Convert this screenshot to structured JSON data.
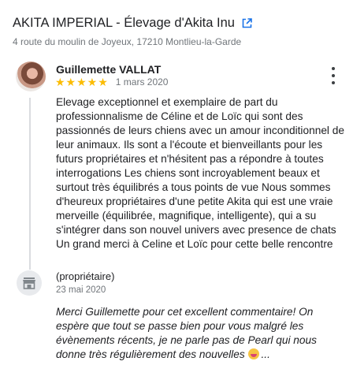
{
  "header": {
    "business_name": "AKITA IMPERIAL - Élevage d'Akita Inu",
    "address": "4 route du moulin de Joyeux, 17210 Montlieu-la-Garde",
    "icons": {
      "external_link": "external-link-icon"
    }
  },
  "review": {
    "reviewer_name": "Guillemette VALLAT",
    "stars": "★★★★★",
    "rating": 5,
    "date": "1 mars 2020",
    "text": "Elevage exceptionnel et exemplaire de part du professionnalisme de Céline et de Loïc qui sont des passionnés de leurs chiens avec un amour inconditionnel de leur animaux. Ils sont a l'écoute et bienveillants pour les futurs propriétaires et n'hésitent pas a répondre à toutes interrogations Les chiens sont incroyablement beaux et surtout très équilibrés a tous points de vue Nous sommes d'heureux propriétaires d'une petite Akita qui est une vraie merveille (équilibrée, magnifique, intelligente), qui a su s'intégrer dans son nouvel univers avec presence de chats Un grand merci à Celine et Loïc pour cette belle rencontre",
    "icons": {
      "menu": "more-vert-icon",
      "star_color": "#fbbc04"
    }
  },
  "owner_reply": {
    "label": "(propriétaire)",
    "date": "23 mai 2020",
    "text": "Merci Guillemette pour cet excellent commentaire! On espère que tout se passe bien pour vous malgré les évènements récents, je ne parle pas de Pearl qui nous donne très régulièrement des nouvelles",
    "ellipsis": "...",
    "icons": {
      "owner": "storefront-icon",
      "emoji": "face-with-tongue-emoji"
    }
  },
  "colors": {
    "link_blue": "#1a73e8",
    "secondary_text": "#70757a"
  }
}
